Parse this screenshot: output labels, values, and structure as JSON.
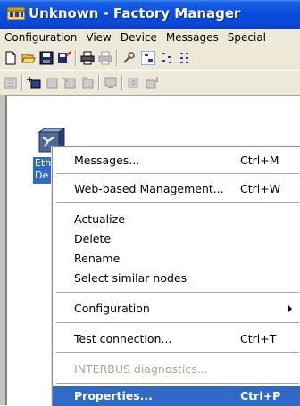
{
  "window": {
    "title": "Unknown - Factory Manager"
  },
  "menubar": {
    "items": [
      "Configuration",
      "View",
      "Device",
      "Messages",
      "Special"
    ]
  },
  "node": {
    "label_line1": "Eth",
    "label_line2": "De"
  },
  "context_menu": {
    "items": [
      {
        "label": "Messages...",
        "shortcut": "Ctrl+M"
      },
      {
        "label": "Web-based Management...",
        "shortcut": "Ctrl+W"
      },
      {
        "label": "Actualize",
        "shortcut": ""
      },
      {
        "label": "Delete",
        "shortcut": ""
      },
      {
        "label": "Rename",
        "shortcut": ""
      },
      {
        "label": "Select similar nodes",
        "shortcut": ""
      },
      {
        "label": "Configuration",
        "shortcut": ""
      },
      {
        "label": "Test connection...",
        "shortcut": "Ctrl+T"
      },
      {
        "label": "INTERBUS diagnostics...",
        "shortcut": ""
      },
      {
        "label": "Properties...",
        "shortcut": "Ctrl+P"
      }
    ]
  },
  "colors": {
    "titlebar": "#0a4de0",
    "selection": "#316ac5",
    "chrome": "#ece9d8",
    "disabled_text": "#aca899"
  }
}
